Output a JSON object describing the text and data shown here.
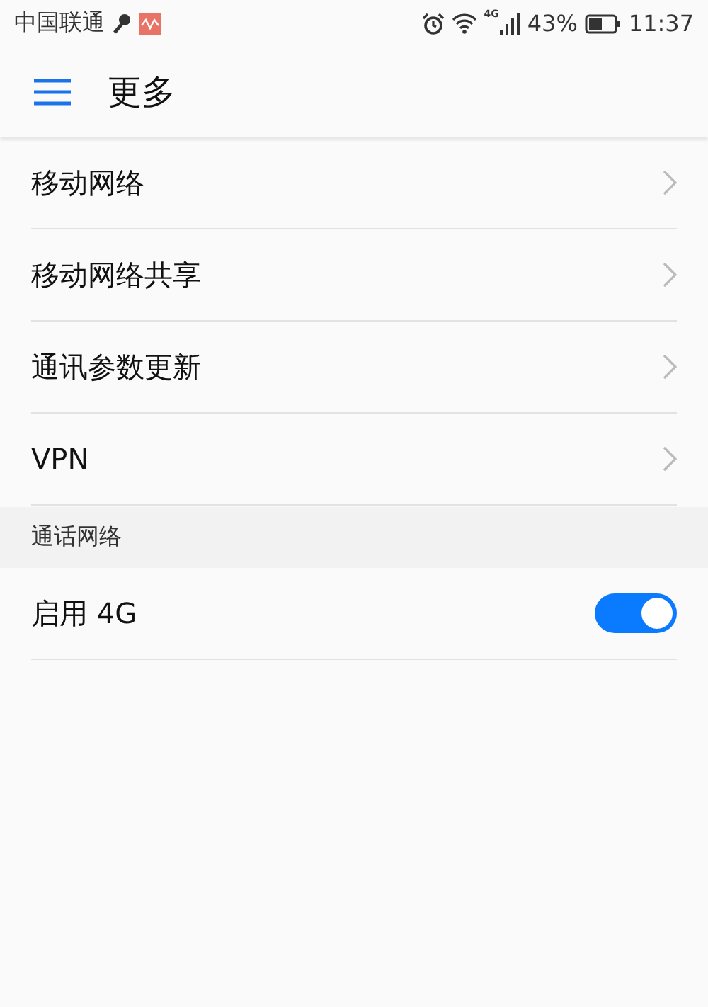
{
  "status_bar": {
    "carrier": "中国联通",
    "network_type": "4G",
    "battery": "43%",
    "time": "11:37"
  },
  "header": {
    "title": "更多"
  },
  "items": [
    {
      "label": "移动网络",
      "kind": "link"
    },
    {
      "label": "移动网络共享",
      "kind": "link"
    },
    {
      "label": "通讯参数更新",
      "kind": "link"
    },
    {
      "label": "VPN",
      "kind": "link"
    }
  ],
  "section": {
    "title": "通话网络",
    "items": [
      {
        "label": "启用 4G",
        "kind": "toggle",
        "on": true
      }
    ]
  }
}
